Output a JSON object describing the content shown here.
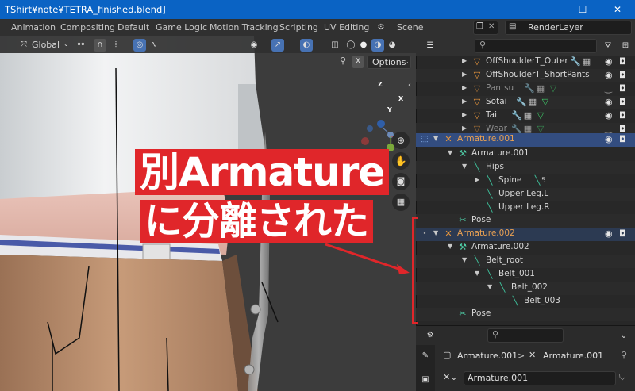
{
  "window": {
    "title": "TShirt¥note¥TETRA_finished.blend]",
    "minimize": "—",
    "maximize": "☐",
    "close": "✕"
  },
  "workspaces": [
    "Animation",
    "Compositing",
    "Default",
    "Game Logic",
    "Motion Tracking",
    "Scripting",
    "UV Editing"
  ],
  "scene": {
    "label": "Scene"
  },
  "view_layer": {
    "label": "RenderLayer"
  },
  "viewport": {
    "orientation": "Global",
    "options_label": "Options",
    "close_x": "X",
    "gizmo": {
      "z": "Z",
      "y": "Y",
      "x": "X"
    }
  },
  "annotation": {
    "line1": "別Armature",
    "line2": "に分離された",
    "color": "#e0262a"
  },
  "outliner": {
    "search_placeholder": "",
    "rows": [
      {
        "label": "OffShoulderT_Outer",
        "kind": "object",
        "dim": false
      },
      {
        "label": "OffShoulderT_ShortPants",
        "kind": "object",
        "dim": false
      },
      {
        "label": "Pantsu",
        "kind": "object",
        "dim": true
      },
      {
        "label": "Sotai",
        "kind": "object",
        "dim": false
      },
      {
        "label": "Tail",
        "kind": "object",
        "dim": false
      },
      {
        "label": "Wear",
        "kind": "object",
        "dim": true
      },
      {
        "label": "Armature.001",
        "kind": "armature-object",
        "dim": false
      },
      {
        "label": "Armature.001",
        "kind": "armature-data",
        "dim": false
      },
      {
        "label": "Hips",
        "kind": "bone",
        "dim": false
      },
      {
        "label": "Spine",
        "kind": "bone",
        "dim": false,
        "badge": "5"
      },
      {
        "label": "Upper Leg.L",
        "kind": "bone",
        "dim": false
      },
      {
        "label": "Upper Leg.R",
        "kind": "bone",
        "dim": false
      },
      {
        "label": "Pose",
        "kind": "pose",
        "dim": false
      },
      {
        "label": "Armature.002",
        "kind": "armature-object",
        "dim": false
      },
      {
        "label": "Armature.002",
        "kind": "armature-data",
        "dim": false
      },
      {
        "label": "Belt_root",
        "kind": "bone",
        "dim": false
      },
      {
        "label": "Belt_001",
        "kind": "bone",
        "dim": false
      },
      {
        "label": "Belt_002",
        "kind": "bone",
        "dim": false
      },
      {
        "label": "Belt_003",
        "kind": "bone",
        "dim": false
      },
      {
        "label": "Pose",
        "kind": "pose",
        "dim": false
      }
    ]
  },
  "properties": {
    "breadcrumb_object": "Armature.001",
    "breadcrumb_sep": ">",
    "breadcrumb_data": "Armature.001",
    "data_name": "Armature.001"
  },
  "colors": {
    "selection": "#334d80",
    "accent": "#4772b3",
    "annotation_red": "#e0262a",
    "titlebar": "#0a63c4"
  }
}
